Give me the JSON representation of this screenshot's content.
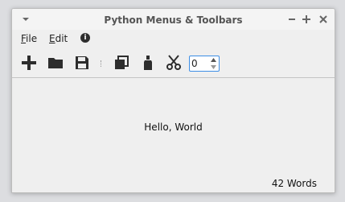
{
  "window": {
    "title": "Python Menus & Toolbars"
  },
  "titlebar": {
    "menu_icon": "chevron-down-icon",
    "minimize_icon": "minimize-icon",
    "maximize_icon": "plus-icon",
    "close_icon": "close-icon"
  },
  "menubar": {
    "items": [
      {
        "label_first": "F",
        "label_rest": "ile"
      },
      {
        "label_first": "E",
        "label_rest": "dit"
      }
    ],
    "info_icon_glyph": "i"
  },
  "toolbar": {
    "icons": [
      "plus-icon",
      "folder-icon",
      "save-icon",
      "copy-icon",
      "paste-bottle-icon",
      "cut-scissors-icon"
    ],
    "spin_value": "0"
  },
  "content": {
    "text": "Hello, World"
  },
  "status": {
    "text": "42 Words"
  },
  "colors": {
    "accent": "#3d8ee5",
    "icon": "#2d2d2d"
  }
}
